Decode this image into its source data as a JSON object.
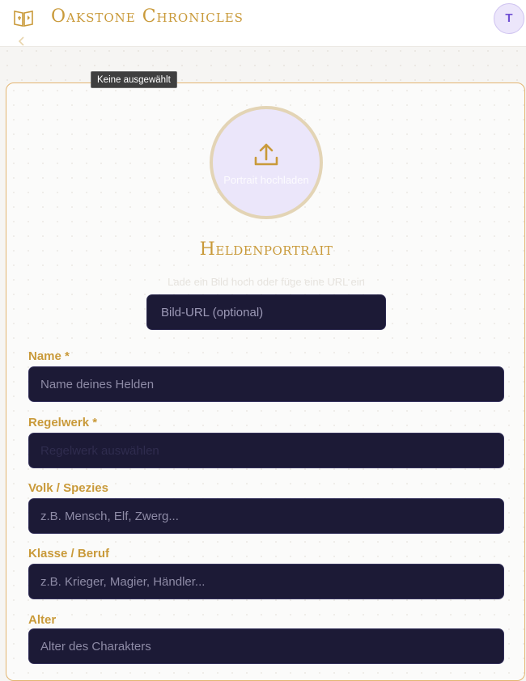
{
  "header": {
    "brand": "Oakstone Chronicles",
    "avatar_initial": "T"
  },
  "tooltip": "Keine ausgewählt",
  "portrait": {
    "upload_label": "Portrait hochladen",
    "title": "Heldenportrait",
    "subtitle": "Lade ein Bild hoch oder füge eine URL ein",
    "url_placeholder": "Bild-URL (optional)"
  },
  "fields": {
    "name": {
      "label": "Name *",
      "placeholder": "Name deines Helden"
    },
    "ruleset": {
      "label": "Regelwerk *",
      "placeholder": "Regelwerk auswählen"
    },
    "species": {
      "label": "Volk / Spezies",
      "placeholder": "z.B. Mensch, Elf, Zwerg..."
    },
    "class": {
      "label": "Klasse / Beruf",
      "placeholder": "z.B. Krieger, Magier, Händler..."
    },
    "age": {
      "label": "Alter",
      "placeholder": "Alter des Charakters"
    }
  },
  "colors": {
    "accent_gold": "#c99a3a",
    "input_bg": "#1c1a36",
    "avatar_bg": "#ece6fb"
  }
}
